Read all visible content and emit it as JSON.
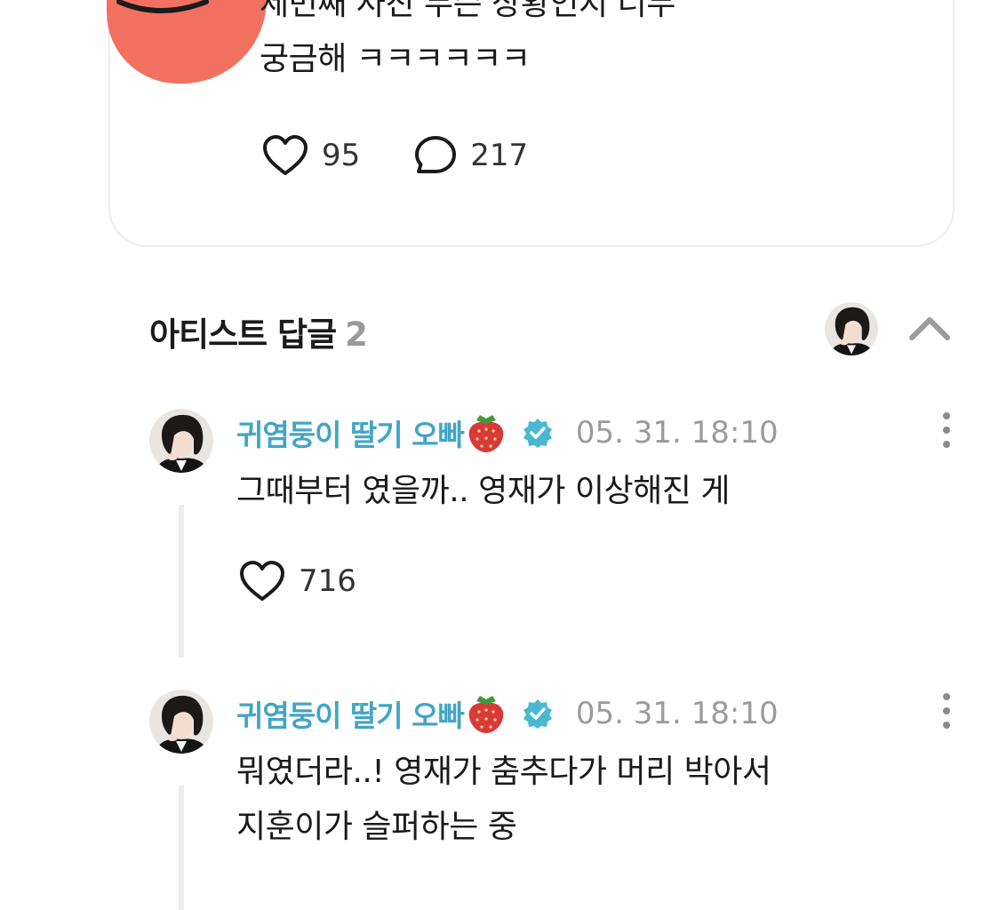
{
  "post": {
    "text": "세번째 사진 무슨 상황인지 너무\n궁금해 ㅋㅋㅋㅋㅋㅋ",
    "likes": "95",
    "comments": "217",
    "avatar_icon": "smiley-face-icon",
    "avatar_color": "#f2705f"
  },
  "artist_replies": {
    "title": "아티스트 답글",
    "count": "2"
  },
  "replies": [
    {
      "name": "귀염둥이 딸기 오빠",
      "time": "05. 31. 18:10",
      "text": "그때부터 였을까.. 영재가 이상해진 게",
      "likes": "716"
    },
    {
      "name": "귀염둥이 딸기 오빠",
      "time": "05. 31. 18:10",
      "text": "뭐였더라..! 영재가 춤추다가 머리 박아서\n지훈이가 슬퍼하는 중"
    }
  ],
  "colors": {
    "artist_name": "#43a5c4",
    "verified": "#4ab8d0",
    "muted": "#9b9b9b"
  }
}
